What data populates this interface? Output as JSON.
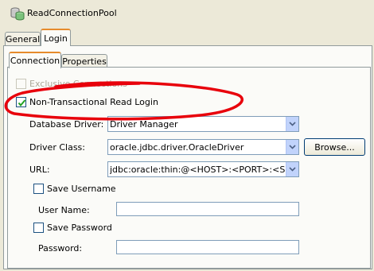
{
  "window": {
    "title": "ReadConnectionPool",
    "icon": "connection-pool-icon"
  },
  "tabs": [
    {
      "label": "General",
      "active": false
    },
    {
      "label": "Login",
      "active": true
    }
  ],
  "subtabs": [
    {
      "label": "Connection",
      "active": true
    },
    {
      "label": "Properties",
      "active": false
    }
  ],
  "connection": {
    "exclusive_connections": {
      "label": "Exclusive Connections",
      "checked": false,
      "enabled": false
    },
    "non_transactional_read_login": {
      "label": "Non-Transactional Read Login",
      "checked": true,
      "enabled": true
    },
    "database_driver": {
      "label": "Database Driver:",
      "value": "Driver Manager"
    },
    "driver_class": {
      "label": "Driver Class:",
      "value": "oracle.jdbc.driver.OracleDriver",
      "browse_label": "Browse..."
    },
    "url": {
      "label": "URL:",
      "value": "jdbc:oracle:thin:@<HOST>:<PORT>:<SID>"
    },
    "save_username": {
      "label": "Save Username",
      "checked": false
    },
    "user_name": {
      "label": "User Name:",
      "value": ""
    },
    "save_password": {
      "label": "Save Password",
      "checked": false
    },
    "password": {
      "label": "Password:",
      "value": ""
    }
  },
  "colors": {
    "background": "#ece9d8",
    "panel": "#fbfbf8",
    "active_tab_accent": "#e68b2c",
    "annotation_red": "#e8000b",
    "check_green": "#21a121"
  }
}
